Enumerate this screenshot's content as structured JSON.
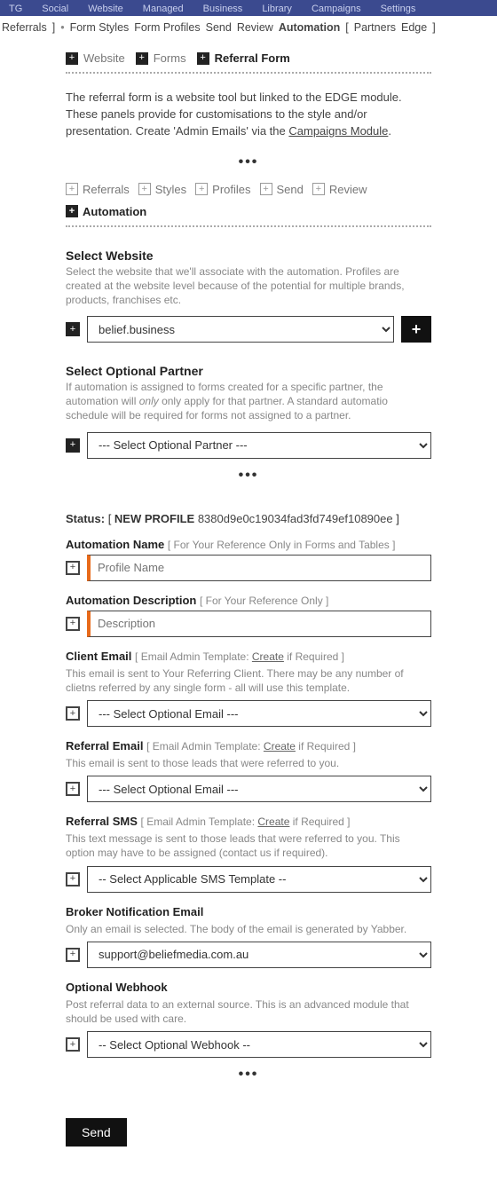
{
  "topnav": {
    "items": [
      "TG",
      "Social",
      "Website",
      "Managed",
      "Business",
      "Library",
      "Campaigns",
      "Settings"
    ]
  },
  "subnav": {
    "left_group_end": "Referrals",
    "right_group": [
      "Form Styles",
      "Form Profiles",
      "Send",
      "Review",
      "Automation"
    ],
    "far_group": [
      "Partners",
      "Edge"
    ]
  },
  "breadcrumb": {
    "items": [
      {
        "label": "Website",
        "active": false
      },
      {
        "label": "Forms",
        "active": false
      },
      {
        "label": "Referral Form",
        "active": true
      }
    ]
  },
  "intro": {
    "text_pre": "The referral form is a website tool but linked to the EDGE module. These panels provide for customisations to the style and/or presentation. Create 'Admin Emails' via the ",
    "link": "Campaigns Module",
    "text_post": "."
  },
  "tabs": {
    "items": [
      {
        "label": "Referrals",
        "active": false
      },
      {
        "label": "Styles",
        "active": false
      },
      {
        "label": "Profiles",
        "active": false
      },
      {
        "label": "Send",
        "active": false
      },
      {
        "label": "Review",
        "active": false
      },
      {
        "label": "Automation",
        "active": true
      }
    ]
  },
  "select_website": {
    "title": "Select Website",
    "help": "Select the website that we'll associate with the automation. Profiles are created at the website level because of the potential for multiple brands, products, franchises etc.",
    "value": "belief.business"
  },
  "select_partner": {
    "title": "Select Optional Partner",
    "help_pre": "If automation is assigned to forms created for a specific partner, the automation will ",
    "help_em": "only",
    "help_post": " only apply for that partner. A standard automatio schedule will be required for forms not assigned to a partner.",
    "value": "--- Select Optional Partner ---"
  },
  "status": {
    "label": "Status:",
    "new_profile": "NEW PROFILE",
    "hash": "8380d9e0c19034fad3fd749ef10890ee"
  },
  "automation_name": {
    "label": "Automation Name",
    "sub": "[ For Your Reference Only in Forms and Tables ]",
    "placeholder": "Profile Name"
  },
  "automation_desc": {
    "label": "Automation Description",
    "sub": "[ For Your Reference Only ]",
    "placeholder": "Description"
  },
  "client_email": {
    "label": "Client Email",
    "sub_pre": "[ Email Admin Template: ",
    "sub_link": "Create",
    "sub_post": " if Required ]",
    "help": "This email is sent to Your Referring Client. There may be any number of clietns referred by any single form - all will use this template.",
    "value": "--- Select Optional Email ---"
  },
  "referral_email": {
    "label": "Referral Email",
    "sub_pre": "[ Email Admin Template: ",
    "sub_link": "Create",
    "sub_post": " if Required ]",
    "help": "This email is sent to those leads that were referred to you.",
    "value": "--- Select Optional Email ---"
  },
  "referral_sms": {
    "label": "Referral SMS",
    "sub_pre": "[ Email Admin Template: ",
    "sub_link": "Create",
    "sub_post": " if Required ]",
    "help": "This text message is sent to those leads that were referred to you. This option may have to be assigned (contact us if required).",
    "value": "-- Select Applicable SMS Template --"
  },
  "broker_email": {
    "label": "Broker Notification Email",
    "help": "Only an email is selected. The body of the email is generated by Yabber.",
    "value": "support@beliefmedia.com.au"
  },
  "webhook": {
    "label": "Optional Webhook",
    "help": "Post referral data to an external source. This is an advanced module that should be used with care.",
    "value": "-- Select Optional Webhook --"
  },
  "send_label": "Send"
}
